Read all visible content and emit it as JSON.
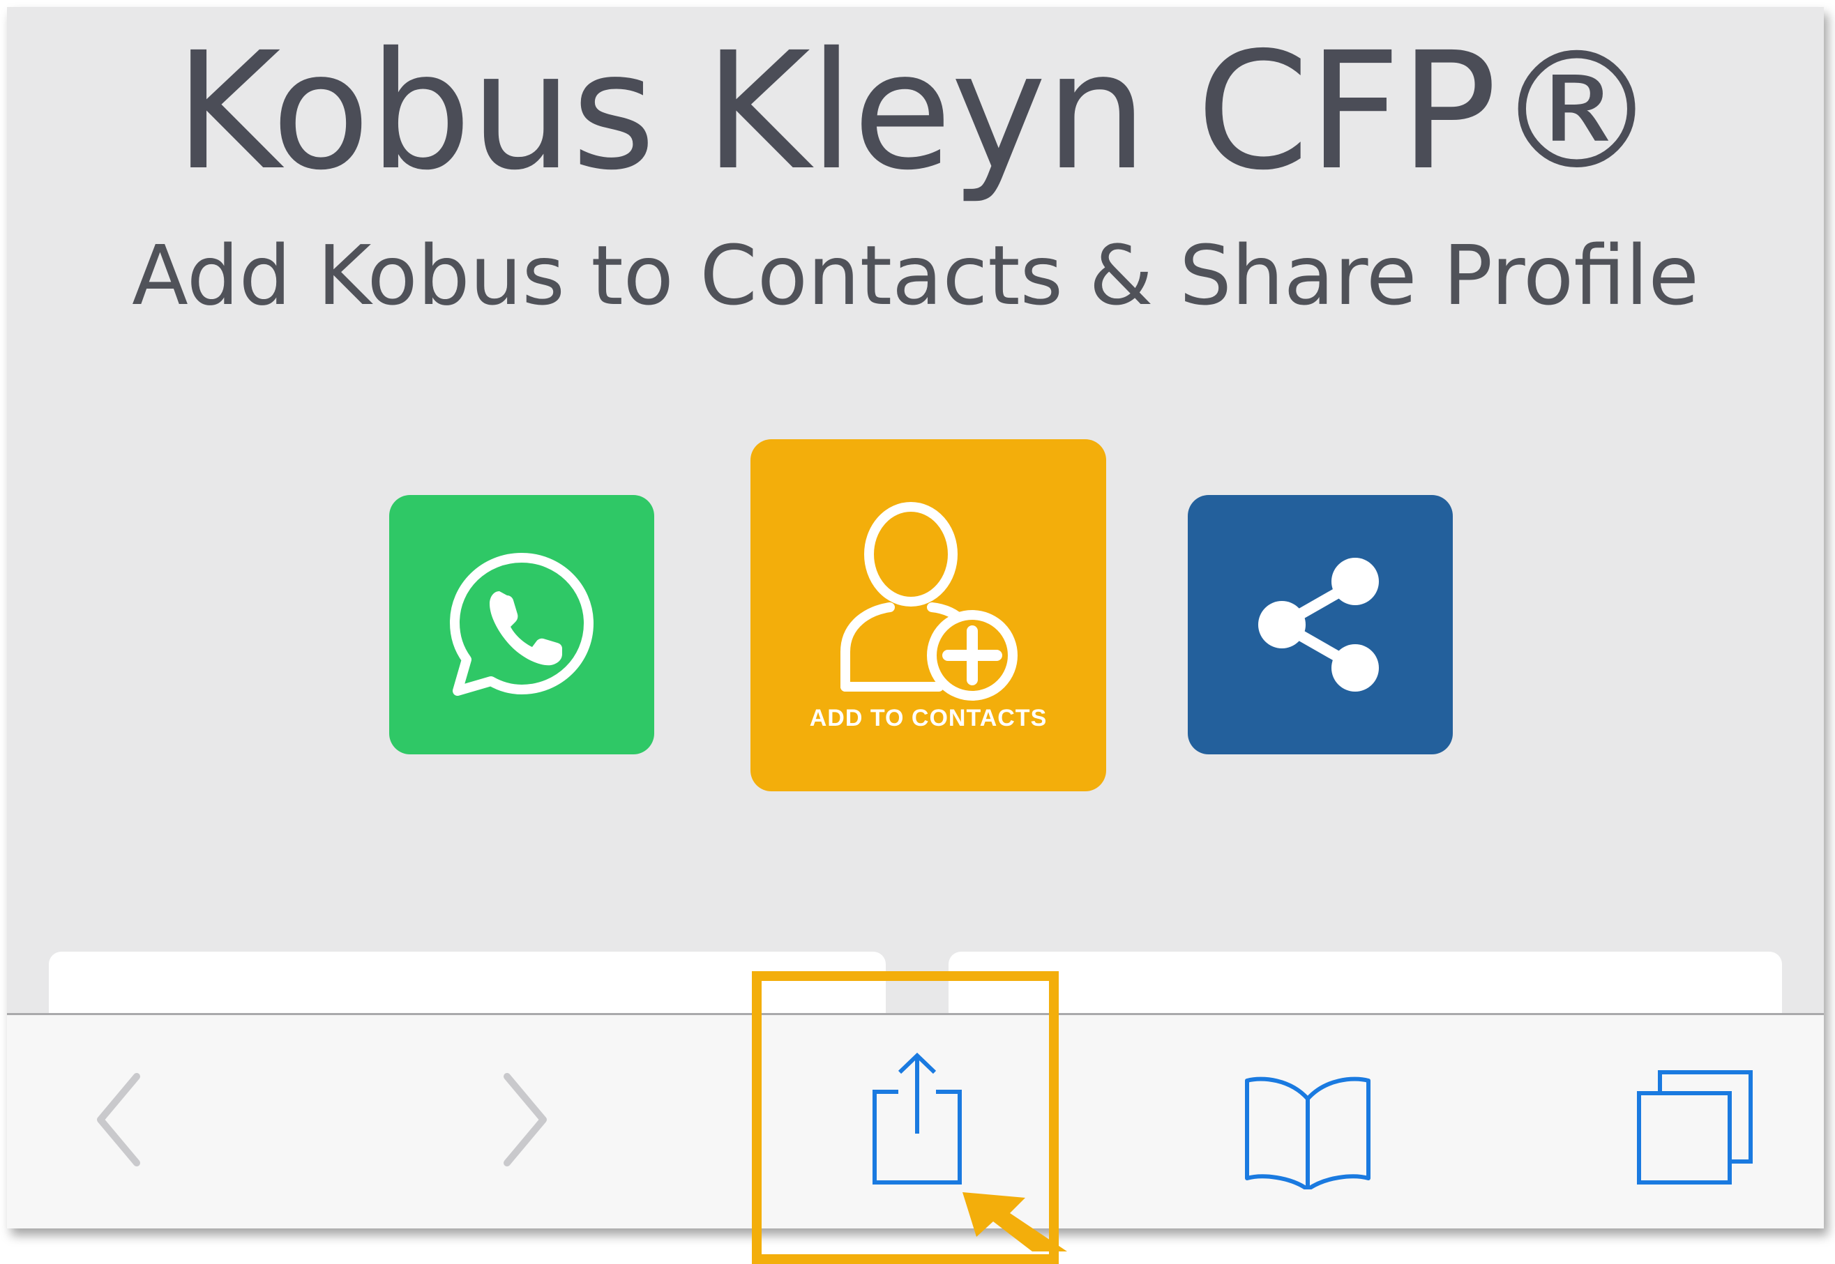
{
  "page": {
    "title": "Kobus Kleyn CFP®",
    "subtitle": "Add Kobus to Contacts & Share Profile"
  },
  "actions": {
    "whatsapp": {
      "icon": "whatsapp-icon"
    },
    "add_contacts": {
      "icon": "add-user-icon",
      "label": "ADD TO CONTACTS"
    },
    "share": {
      "icon": "share-icon"
    }
  },
  "toolbar": {
    "items": [
      {
        "icon": "chevron-left-icon",
        "enabled": false
      },
      {
        "icon": "chevron-right-icon",
        "enabled": false
      },
      {
        "icon": "share-upload-icon",
        "enabled": true,
        "highlighted": true
      },
      {
        "icon": "bookmarks-book-icon",
        "enabled": true
      },
      {
        "icon": "tabs-icon",
        "enabled": true
      }
    ]
  },
  "colors": {
    "background": "#e8e8e9",
    "whatsapp_green": "#2fc866",
    "contacts_orange": "#f3ae0b",
    "share_blue": "#23609c",
    "ios_blue": "#1a7ae0",
    "disabled_gray": "#c9c9cc",
    "highlight": "#f3ae0b"
  }
}
